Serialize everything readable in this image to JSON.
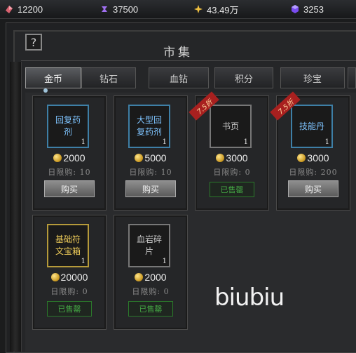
{
  "resources": [
    {
      "name": "gem-red",
      "value": "12200",
      "color": "#e0707a"
    },
    {
      "name": "crystal-purple",
      "value": "37500",
      "color": "#b07cff"
    },
    {
      "name": "gold-sparkle",
      "value": "43.49万",
      "color": "#f0c040"
    },
    {
      "name": "orb-purple",
      "value": "3253",
      "color": "#8a5cff"
    }
  ],
  "window": {
    "title": "市集",
    "help_label": "?"
  },
  "tabs": [
    {
      "label": "金币",
      "active": true
    },
    {
      "label": "钻石"
    },
    {
      "label": "血钻"
    },
    {
      "label": "积分"
    },
    {
      "label": "珍宝"
    }
  ],
  "items": [
    {
      "name": "回复药剂",
      "count": "1",
      "price": "2000",
      "limit": "日限购: 10",
      "action": "购买",
      "frame": "blue",
      "discount": ""
    },
    {
      "name": "大型回复药剂",
      "count": "1",
      "price": "5000",
      "limit": "日限购: 10",
      "action": "购买",
      "frame": "blue",
      "discount": ""
    },
    {
      "name": "书页",
      "count": "1",
      "price": "3000",
      "limit": "日限购: 0",
      "action": "已售罄",
      "frame": "gray",
      "discount": "7.5折"
    },
    {
      "name": "技能丹",
      "count": "1",
      "price": "3000",
      "limit": "日限购: 200",
      "action": "购买",
      "frame": "blue",
      "discount": "7.5折"
    },
    {
      "name": "基础符文宝箱",
      "count": "1",
      "price": "20000",
      "limit": "日限购: 0",
      "action": "已售罄",
      "frame": "gold",
      "discount": ""
    },
    {
      "name": "血岩碎片",
      "count": "1",
      "price": "2000",
      "limit": "日限购: 0",
      "action": "已售罄",
      "frame": "gray",
      "discount": ""
    }
  ],
  "watermark": "biubiu",
  "colors": {
    "accent_blue": "#3e7fa6",
    "sold_green": "#45a845",
    "discount_red": "#a8201f"
  }
}
